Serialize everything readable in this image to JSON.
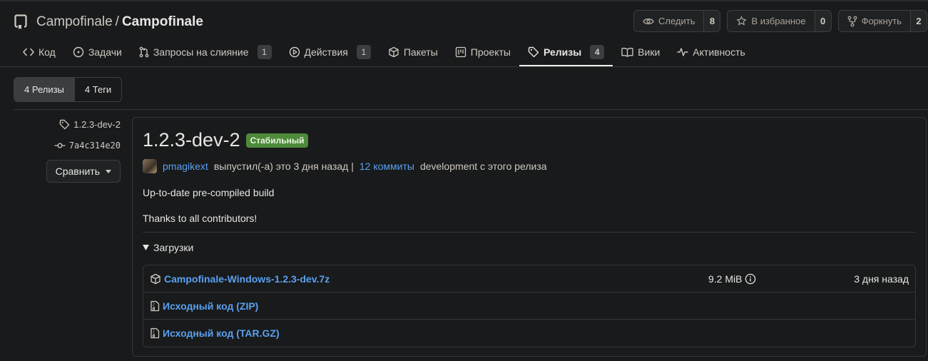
{
  "repo": {
    "owner": "Campofinale",
    "separator": "/",
    "name": "Campofinale"
  },
  "actions": [
    {
      "label": "Следить",
      "count": "8",
      "icon": "eye-icon"
    },
    {
      "label": "В избранное",
      "count": "0",
      "icon": "star-icon"
    },
    {
      "label": "Форкнуть",
      "count": "2",
      "icon": "fork-icon"
    }
  ],
  "nav": [
    {
      "label": "Код",
      "icon": "code-icon",
      "counter": null
    },
    {
      "label": "Задачи",
      "icon": "issue-icon",
      "counter": null
    },
    {
      "label": "Запросы на слияние",
      "icon": "pull-request-icon",
      "counter": "1"
    },
    {
      "label": "Действия",
      "icon": "play-icon",
      "counter": "1"
    },
    {
      "label": "Пакеты",
      "icon": "package-icon",
      "counter": null
    },
    {
      "label": "Проекты",
      "icon": "project-icon",
      "counter": null
    },
    {
      "label": "Релизы",
      "icon": "tag-icon",
      "counter": "4",
      "active": true
    },
    {
      "label": "Вики",
      "icon": "book-icon",
      "counter": null
    },
    {
      "label": "Активность",
      "icon": "pulse-icon",
      "counter": null
    }
  ],
  "subnav": {
    "releases": "4 Релизы",
    "tags": "4 Теги"
  },
  "release": {
    "tag": "1.2.3-dev-2",
    "commit": "7a4c314e20",
    "compare_label": "Сравнить",
    "title": "1.2.3-dev-2",
    "badge": "Стабильный",
    "author": "pmagikext",
    "published_text": "выпустил(-а) это 3 дня назад |",
    "commits_link": "12 коммиты",
    "commits_suffix": "development с этого релиза",
    "body": [
      "Up-to-date pre-compiled build",
      "Thanks to all contributors!"
    ],
    "downloads_label": "Загрузки",
    "assets": [
      {
        "name": "Campofinale-Windows-1.2.3-dev.7z",
        "size": "9.2 MiB",
        "date": "3 дня назад",
        "icon": "package-icon"
      },
      {
        "name": "Исходный код (ZIP)",
        "icon": "file-zip-icon"
      },
      {
        "name": "Исходный код (TAR.GZ)",
        "icon": "file-zip-icon"
      }
    ]
  },
  "colors": {
    "accent": "#5aa0ef",
    "badge": "#4d8a3a",
    "background": "#181a1b"
  }
}
